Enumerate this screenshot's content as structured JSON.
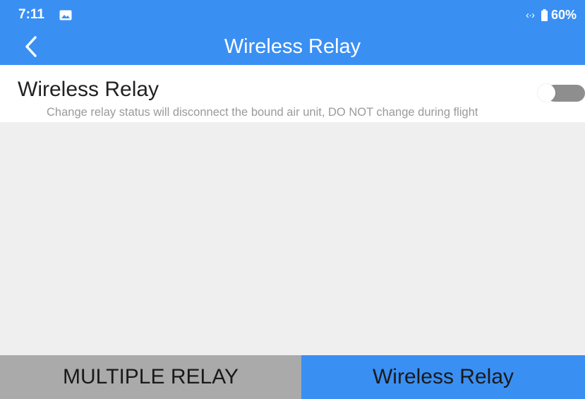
{
  "status_bar": {
    "time": "7:11",
    "battery_level": "60%",
    "icons": [
      "image-icon",
      "data-transfer-icon",
      "battery-icon"
    ]
  },
  "app_bar": {
    "title": "Wireless Relay",
    "back_icon": "chevron-left-icon"
  },
  "setting": {
    "title": "Wireless Relay",
    "description": "Change relay status will disconnect the bound air unit, DO NOT change during flight",
    "enabled": false
  },
  "tabs": [
    {
      "label": "MULTIPLE RELAY",
      "selected": false
    },
    {
      "label": "Wireless Relay",
      "selected": true
    }
  ],
  "colors": {
    "accent": "#3a8ff3",
    "content_background": "#efefef",
    "inactive_tab": "#aaaaaa",
    "toggle_off_track": "#8e8e8e",
    "description_text": "#9a9a9a"
  }
}
